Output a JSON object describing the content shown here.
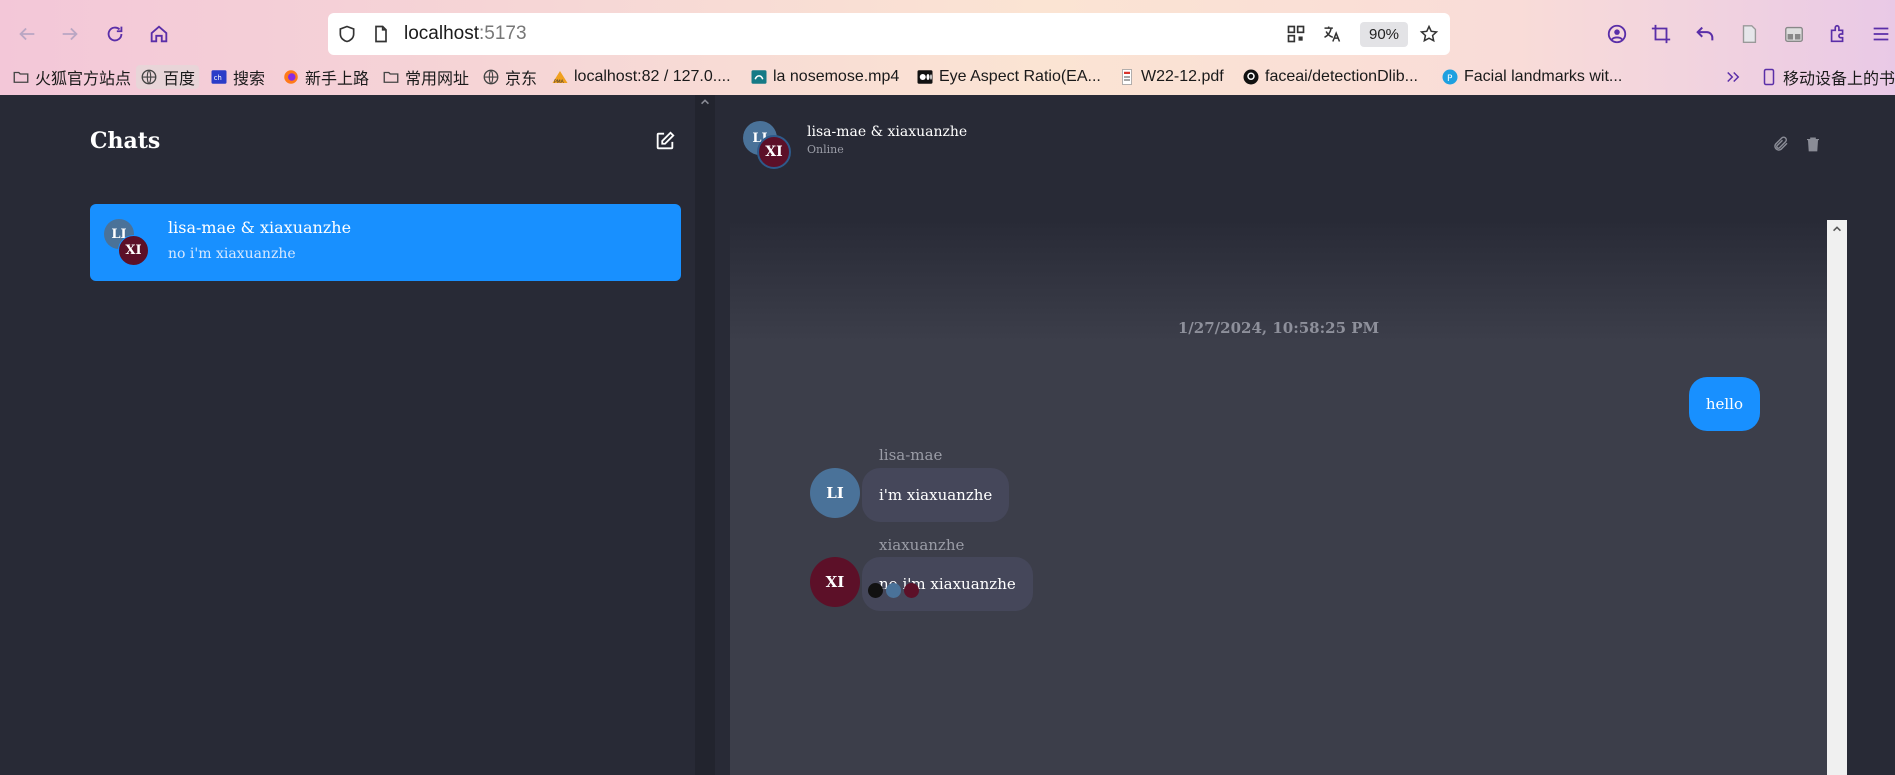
{
  "browser": {
    "url_host": "localhost",
    "url_port": ":5173",
    "zoom": "90%",
    "bookmarks": [
      {
        "label": "火狐官方站点",
        "icon": "folder-icon"
      },
      {
        "label": "百度",
        "icon": "globe-icon"
      },
      {
        "label": "搜索",
        "icon": "search-site-icon"
      },
      {
        "label": "新手上路",
        "icon": "firefox-icon"
      },
      {
        "label": "常用网址",
        "icon": "folder-icon"
      },
      {
        "label": "京东",
        "icon": "globe-icon"
      },
      {
        "label": "localhost:82 / 127.0....",
        "icon": "pma-icon"
      },
      {
        "label": "la nosemose.mp4",
        "icon": "video-icon"
      },
      {
        "label": "Eye Aspect Ratio(EA...",
        "icon": "medium-icon"
      },
      {
        "label": "W22-12.pdf",
        "icon": "pdf-icon"
      },
      {
        "label": "faceai/detectionDlib...",
        "icon": "github-icon"
      },
      {
        "label": "Facial landmarks wit...",
        "icon": "pyimage-icon"
      }
    ],
    "mobile_bookmarks": "移动设备上的书签"
  },
  "sidebar": {
    "title": "Chats",
    "chats": [
      {
        "name": "lisa-mae & xiaxuanzhe",
        "preview": "no i'm xiaxuanzhe",
        "avatar1": "LI",
        "avatar2": "XI"
      }
    ]
  },
  "chat": {
    "title": "lisa-mae & xiaxuanzhe",
    "status": "Online",
    "avatar1": "LI",
    "avatar2": "XI",
    "timestamp": "1/27/2024, 10:58:25 PM",
    "messages": [
      {
        "sender": "",
        "text": "hello",
        "own": true
      },
      {
        "sender": "lisa-mae",
        "avatar": "LI",
        "text": "i'm xiaxuanzhe",
        "own": false
      },
      {
        "sender": "xiaxuanzhe",
        "avatar": "XI",
        "text": "no i'm xiaxuanzhe",
        "own": false
      }
    ]
  },
  "colors": {
    "accent": "#1890ff",
    "avatar_li": "#4a7299",
    "avatar_xi": "#5c1028",
    "read_dot_1": "#111111"
  }
}
